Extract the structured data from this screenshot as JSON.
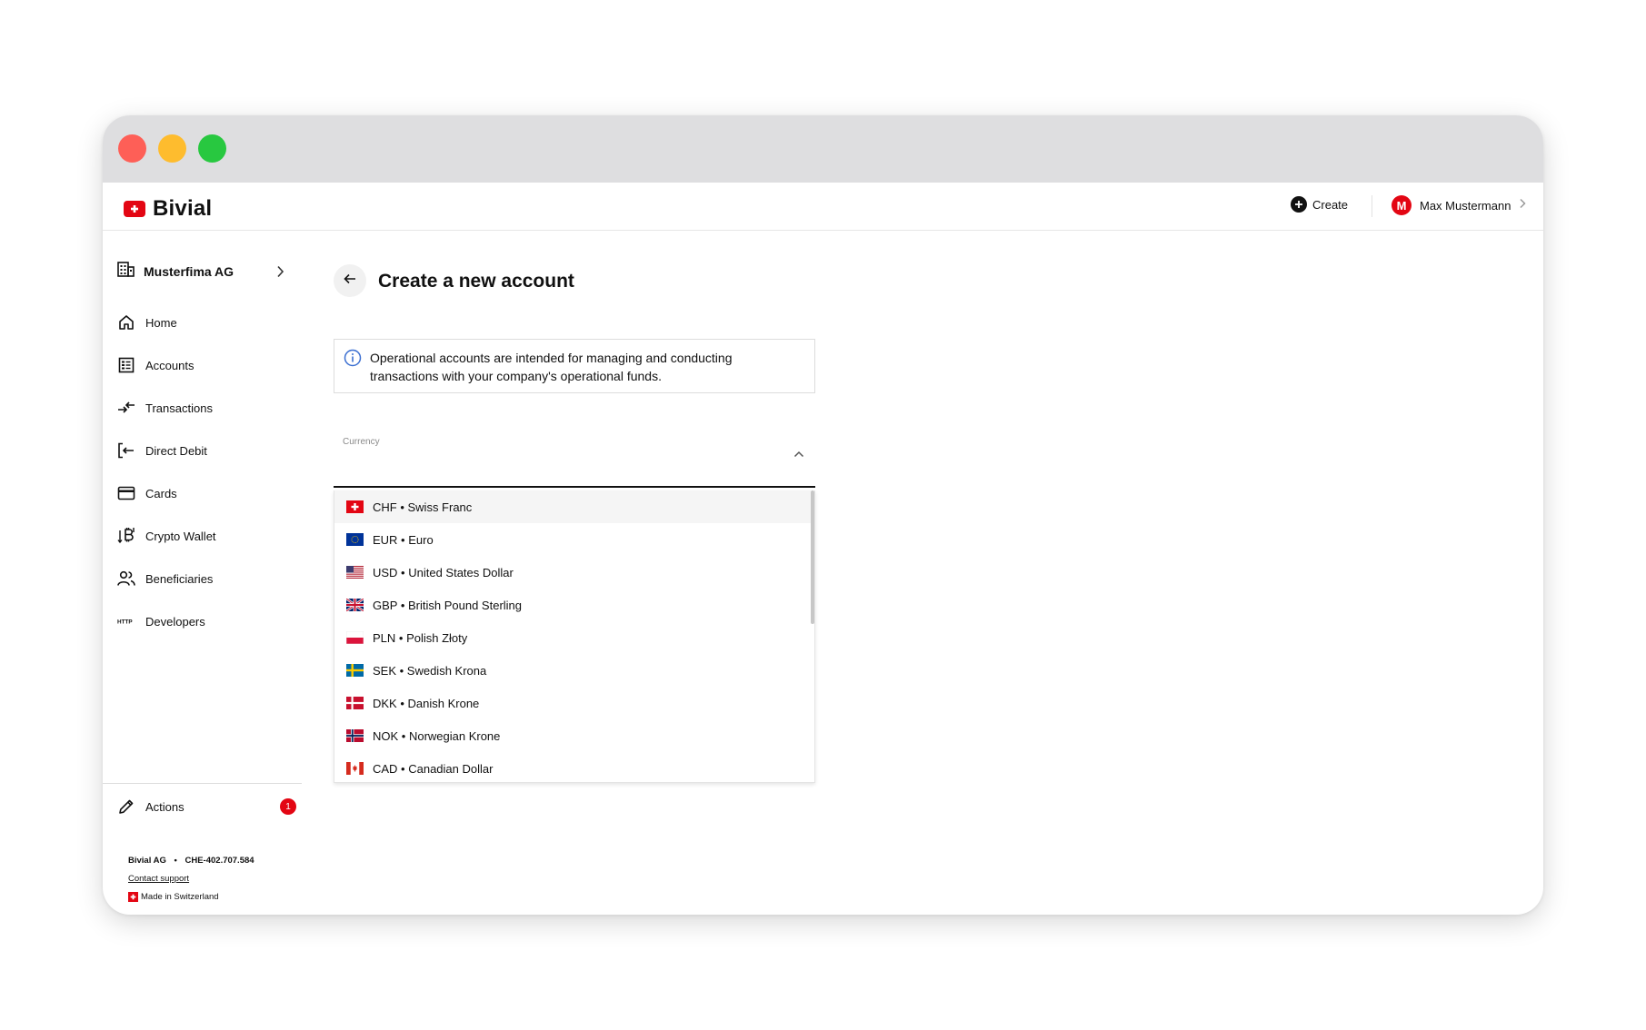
{
  "brand": {
    "name": "Bivial",
    "accent": "#e30613"
  },
  "header": {
    "create_label": "Create",
    "user_initial": "M",
    "user_name": "Max Mustermann"
  },
  "sidebar": {
    "org_name": "Musterfima AG",
    "items": [
      {
        "label": "Home",
        "icon": "home-icon"
      },
      {
        "label": "Accounts",
        "icon": "accounts-icon"
      },
      {
        "label": "Transactions",
        "icon": "transactions-icon"
      },
      {
        "label": "Direct Debit",
        "icon": "direct-debit-icon"
      },
      {
        "label": "Cards",
        "icon": "card-icon"
      },
      {
        "label": "Crypto Wallet",
        "icon": "crypto-wallet-icon"
      },
      {
        "label": "Beneficiaries",
        "icon": "beneficiaries-icon"
      },
      {
        "label": "Developers",
        "icon": "http-icon"
      }
    ],
    "actions": {
      "label": "Actions",
      "badge": "1",
      "icon": "pencil-icon"
    }
  },
  "footer": {
    "company": "Bivial AG",
    "separator": "•",
    "reg_number": "CHE-402.707.584",
    "support_link": "Contact support",
    "made_in": "Made in Switzerland"
  },
  "main": {
    "title": "Create a new account",
    "info_text": "Operational accounts are intended for managing and conducting transactions with your company's operational funds.",
    "currency_field": {
      "label": "Currency",
      "options": [
        {
          "code": "CHF",
          "name": "Swiss Franc",
          "text": "CHF • Swiss Franc"
        },
        {
          "code": "EUR",
          "name": "Euro",
          "text": "EUR • Euro"
        },
        {
          "code": "USD",
          "name": "United States Dollar",
          "text": "USD • United States Dollar"
        },
        {
          "code": "GBP",
          "name": "British Pound Sterling",
          "text": "GBP • British Pound Sterling"
        },
        {
          "code": "PLN",
          "name": "Polish Złoty",
          "text": "PLN • Polish Złoty"
        },
        {
          "code": "SEK",
          "name": "Swedish Krona",
          "text": "SEK • Swedish Krona"
        },
        {
          "code": "DKK",
          "name": "Danish Krone",
          "text": "DKK • Danish Krone"
        },
        {
          "code": "NOK",
          "name": "Norwegian Krone",
          "text": "NOK • Norwegian Krone"
        },
        {
          "code": "CAD",
          "name": "Canadian Dollar",
          "text": "CAD • Canadian Dollar"
        }
      ]
    }
  }
}
